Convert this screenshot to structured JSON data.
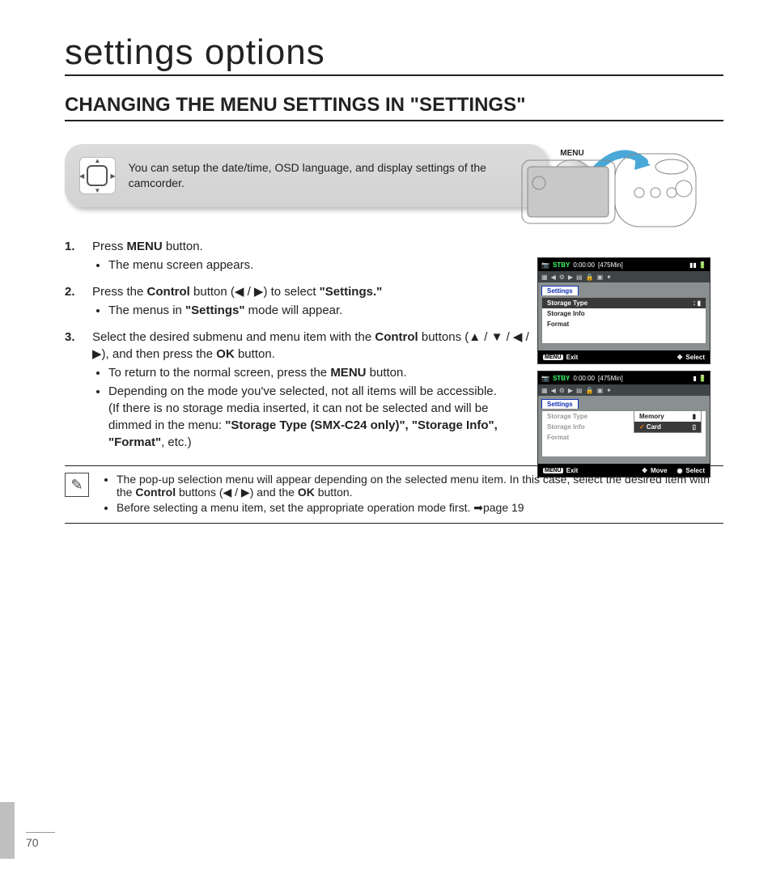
{
  "page": {
    "title": "settings options",
    "subtitle": "CHANGING THE MENU SETTINGS IN \"SETTINGS\"",
    "number": "70"
  },
  "infobox": {
    "text": "You can setup the date/time, OSD language, and display settings of the camcorder.",
    "menu_label": "MENU"
  },
  "steps": {
    "s1": {
      "text_a": "Press ",
      "bold_a": "MENU",
      "text_b": " button.",
      "bul1": "The menu screen appears."
    },
    "s2": {
      "text_a": "Press the ",
      "bold_a": "Control",
      "text_b": " button (◀ / ▶) to select ",
      "bold_b": "\"Settings.\"",
      "bul1_a": "The menus in ",
      "bul1_bold": "\"Settings\"",
      "bul1_b": " mode will appear."
    },
    "s3": {
      "text_a": "Select the desired submenu and menu item with the ",
      "bold_a": "Control",
      "text_b": " buttons (▲ / ▼ / ◀ / ▶), and then press the ",
      "bold_b": "OK",
      "text_c": " button.",
      "bul1_a": "To return to the normal screen, press the ",
      "bul1_bold": "MENU",
      "bul1_b": " button.",
      "bul2": "Depending on the mode you've selected, not all items will be accessible.",
      "bul3_a": "(If there is no storage media inserted, it can not be selected and will be dimmed in the menu: ",
      "bul3_bold": "\"Storage Type (SMX-C24 only)\", \"Storage Info\", \"Format\"",
      "bul3_b": ", etc.)"
    }
  },
  "notes": {
    "n1_a": "The pop-up selection menu will appear depending on the selected menu item. In this case, select the desired item with the ",
    "n1_bold1": "Control",
    "n1_b": " buttons (◀ / ▶) and the ",
    "n1_bold2": "OK",
    "n1_c": " button.",
    "n2": "Before selecting a menu item, set the appropriate operation mode first. ➡page 19"
  },
  "screen": {
    "stby": "STBY",
    "time": "0:00:00",
    "remain": "[475Min]",
    "tab": "Settings",
    "row_storage_type": "Storage Type",
    "row_storage_info": "Storage Info",
    "row_format": "Format",
    "bot_menu": "MENU",
    "bot_exit": "Exit",
    "bot_select": "Select",
    "bot_move": "Move",
    "popup_memory": "Memory",
    "popup_card": "Card"
  }
}
